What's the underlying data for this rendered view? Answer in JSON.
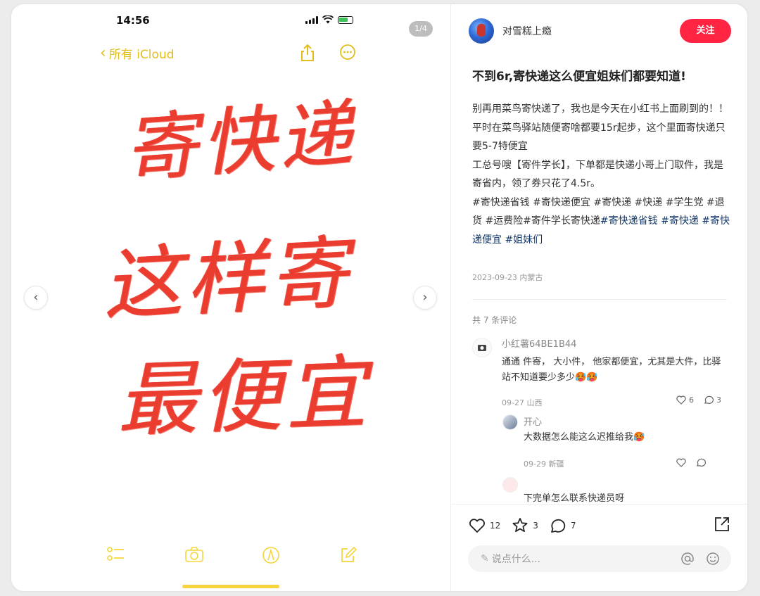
{
  "phone": {
    "time": "14:56",
    "page_indicator": "1/4",
    "back_label": "所有 iCloud",
    "handwriting_lines": [
      "寄快递",
      "这样寄",
      "最便宜"
    ]
  },
  "post": {
    "author": "对雪糕上瘾",
    "follow_label": "关注",
    "title": "不到6r,寄快递这么便宜姐妹们都要知道!",
    "body_lines": [
      "别再用菜鸟寄快递了，我也是今天在小红书上面刷到的！！",
      "平时在菜鸟驿站随便寄啥都要15r起步，这个里面寄快递只要5-7特便宜",
      "工总号嗖【寄件学长】，下单都是快递小哥上门取件，我是寄省内，领了券只花了4.5r。"
    ],
    "tags_plain": "#寄快递省钱 #寄快递便宜 #寄快递 #快递 #学生党 #退货 #运费险#寄件学长寄快递",
    "tags_link": "#寄快递省钱 #寄快递 #寄快递便宜 #姐妹们",
    "date_location": "2023-09-23 内蒙古"
  },
  "comments": {
    "count_label": "共 7 条评论",
    "items": [
      {
        "name": "小红薯64BE1B44",
        "text": "通通 件寄， 大小件， 他家都便宜，尤其是大件，比驿站不知道要少多少🥵🥵",
        "meta": "09-27 山西",
        "likes": "6",
        "replies": "3"
      },
      {
        "name": "开心",
        "text": "大数据怎么能这么迟推给我🥵",
        "meta": "09-29 新疆",
        "likes": "",
        "replies": ""
      },
      {
        "name": "",
        "text": "下完单怎么联系快递员呀",
        "meta": "",
        "likes": "",
        "replies": ""
      }
    ]
  },
  "engagement": {
    "likes": "12",
    "collects": "3",
    "comments": "7"
  },
  "comment_input": {
    "placeholder": "说点什么..."
  },
  "colors": {
    "accent": "#ff2442",
    "notes_yellow": "#e3bd1c",
    "ink_red": "#ea3d30",
    "tag_blue": "#13386c"
  }
}
